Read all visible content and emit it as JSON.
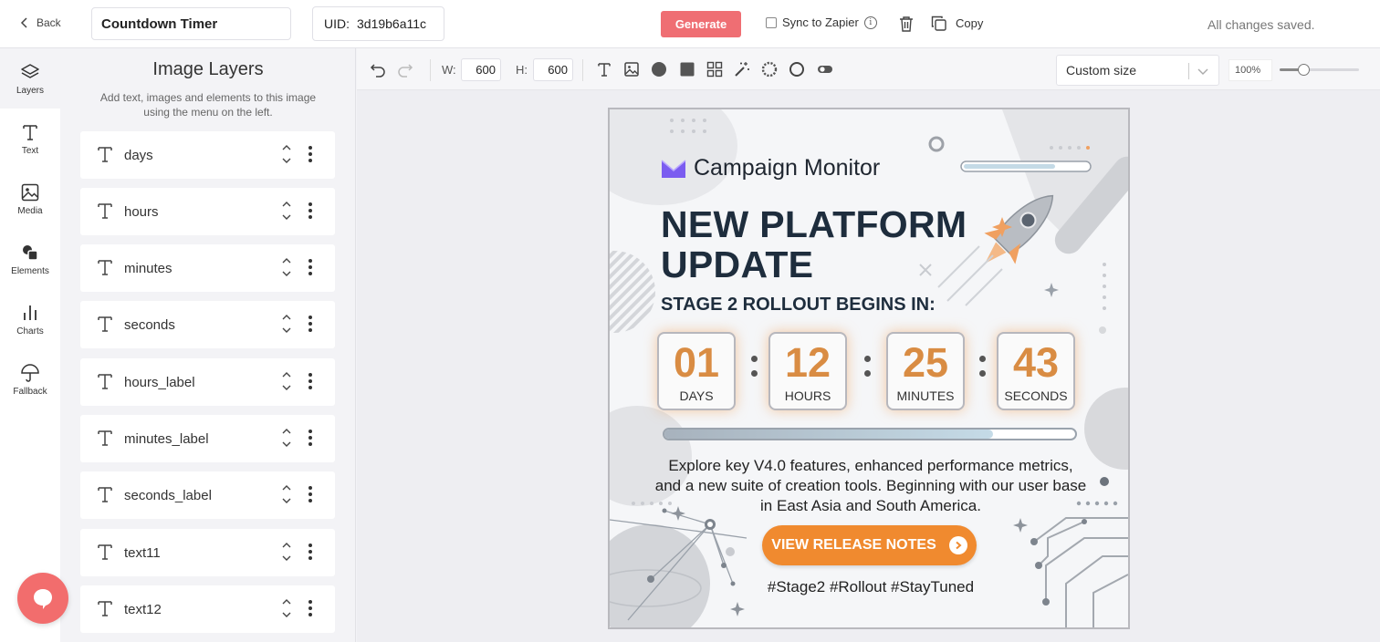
{
  "topbar": {
    "back_label": "Back",
    "title_value": "Countdown Timer",
    "uid_label": "UID:",
    "uid_value": "3d19b6a11c",
    "generate_label": "Generate",
    "sync_label": "Sync to Zapier",
    "copy_label": "Copy",
    "status": "All changes saved."
  },
  "rail": {
    "items": [
      {
        "label": "Layers",
        "icon": "layers-icon"
      },
      {
        "label": "Text",
        "icon": "text-icon"
      },
      {
        "label": "Media",
        "icon": "image-icon"
      },
      {
        "label": "Elements",
        "icon": "shapes-icon"
      },
      {
        "label": "Charts",
        "icon": "bar-chart-icon"
      },
      {
        "label": "Fallback",
        "icon": "umbrella-icon"
      }
    ]
  },
  "panel": {
    "title": "Image Layers",
    "subtitle": "Add text, images and elements to this image using the menu on the left.",
    "layers": [
      {
        "name": "days"
      },
      {
        "name": "hours"
      },
      {
        "name": "minutes"
      },
      {
        "name": "seconds"
      },
      {
        "name": "hours_label"
      },
      {
        "name": "minutes_label"
      },
      {
        "name": "seconds_label"
      },
      {
        "name": "text11"
      },
      {
        "name": "text12"
      }
    ]
  },
  "toolbar": {
    "width_label": "W:",
    "width_value": "600",
    "height_label": "H:",
    "height_value": "600",
    "size_preset": "Custom size",
    "zoom": "100%",
    "zoom_fraction": 0.3
  },
  "design": {
    "brand": "Campaign Monitor",
    "headline_line1": "NEW PLATFORM",
    "headline_line2": "UPDATE",
    "subhead": "STAGE 2 ROLLOUT BEGINS IN:",
    "countdown": [
      {
        "value": "01",
        "label": "DAYS"
      },
      {
        "value": "12",
        "label": "HOURS"
      },
      {
        "value": "25",
        "label": "MINUTES"
      },
      {
        "value": "43",
        "label": "SECONDS"
      }
    ],
    "progress_fraction": 0.8,
    "body_text": "Explore key V4.0 features, enhanced performance metrics, and a new suite of creation tools. Beginning with our user base in East Asia and South America.",
    "cta_label": "VIEW RELEASE NOTES",
    "hashtags": "#Stage2 #Rollout #StayTuned",
    "accent_color": "#f08a2f",
    "brand_color": "#7b5cf0"
  }
}
